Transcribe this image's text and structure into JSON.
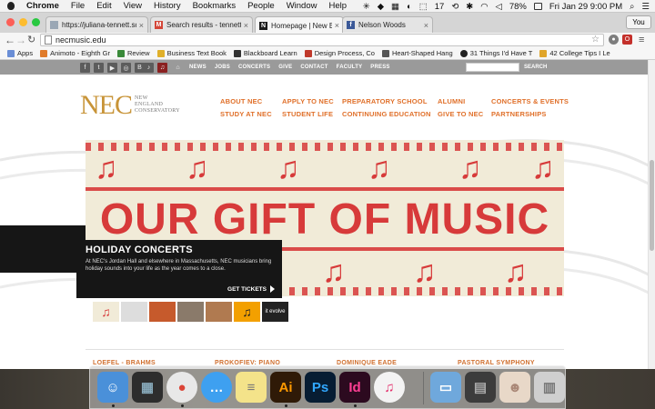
{
  "menubar": {
    "app": "Chrome",
    "items": [
      "File",
      "Edit",
      "View",
      "History",
      "Bookmarks",
      "People",
      "Window",
      "Help"
    ],
    "badge_count": "17",
    "battery": "78%",
    "clock": "Fri Jan 29  9:00 PM"
  },
  "tabs": [
    {
      "title": "https://juliana-tennett.squ",
      "icon_color": "#9aa7b5",
      "icon": "doc-icon"
    },
    {
      "title": "Search results - tennett.jl@",
      "icon_color": "#d44638",
      "icon": "gmail-icon"
    },
    {
      "title": "Homepage | New England C",
      "icon_color": "#1a1a1a",
      "icon": "nec-icon"
    },
    {
      "title": "Nelson Woods",
      "icon_color": "#3b5998",
      "icon": "facebook-icon"
    }
  ],
  "profile_label": "You",
  "url": "necmusic.edu",
  "bookmarks": [
    {
      "label": "Apps",
      "color": "#6a8ed6"
    },
    {
      "label": "Animoto - Eighth Gr",
      "color": "#e07b2a"
    },
    {
      "label": "Review",
      "color": "#3a8a3a"
    },
    {
      "label": "Business Text Book",
      "color": "#e0b02a"
    },
    {
      "label": "Blackboard Learn",
      "color": "#333333"
    },
    {
      "label": "Design Process, Co",
      "color": "#c0392b"
    },
    {
      "label": "Heart-Shaped Hang",
      "color": "#555555"
    },
    {
      "label": "31 Things I'd Have T",
      "color": "#222222"
    },
    {
      "label": "42 College Tips I Le",
      "color": "#e0a52a"
    }
  ],
  "site": {
    "top_nav": [
      "NEWS",
      "JOBS",
      "CONCERTS",
      "GIVE",
      "CONTACT",
      "FACULTY",
      "PRESS"
    ],
    "search_label": "SEARCH",
    "logo_main": "NEC",
    "logo_sub": [
      "NEW",
      "ENGLAND",
      "CONSERVATORY"
    ],
    "main_nav_row1": [
      "ABOUT NEC",
      "APPLY TO NEC",
      "PREPARATORY SCHOOL",
      "ALUMNI",
      "CONCERTS & EVENTS"
    ],
    "main_nav_row2": [
      "STUDY AT NEC",
      "STUDENT LIFE",
      "CONTINUING EDUCATION",
      "GIVE TO NEC",
      "PARTNERSHIPS"
    ],
    "hero_text": "OUR GIFT OF MUSIC",
    "hero_note_glyph": "♫",
    "promo_heading": "HOLIDAY CONCERTS",
    "promo_body": "At NEC's Jordan Hall and elsewhere in Massachusetts, NEC musicians bring holiday sounds into your life as the year comes to a close.",
    "promo_cta": "GET TICKETS",
    "thumb_last_label": "it evolve",
    "bottom_items": [
      "LOEFEL - BRAHMS",
      "PROKOFIEV: PIANO",
      "DOMINIQUE EADE",
      "PASTORAL SYMPHONY"
    ]
  },
  "dock": [
    {
      "name": "finder-icon",
      "bg": "#4a90d9",
      "glyph": "☺"
    },
    {
      "name": "mission-control-icon",
      "bg": "#2d2d2d",
      "glyph": "▦"
    },
    {
      "name": "chrome-icon",
      "bg": "#e8e8e8",
      "glyph": "●"
    },
    {
      "name": "messages-icon",
      "bg": "#3ea0f0",
      "glyph": "💬"
    },
    {
      "name": "notes-icon",
      "bg": "#f4e38a",
      "glyph": "≡"
    },
    {
      "name": "illustrator-icon",
      "bg": "#2f1a07",
      "glyph": "Ai"
    },
    {
      "name": "photoshop-icon",
      "bg": "#071d33",
      "glyph": "Ps"
    },
    {
      "name": "indesign-icon",
      "bg": "#2c0a1f",
      "glyph": "Id"
    },
    {
      "name": "itunes-icon",
      "bg": "#f3f3f3",
      "glyph": "♫"
    },
    {
      "name": "folder-icon",
      "bg": "#6fa8dc",
      "glyph": "▭"
    },
    {
      "name": "document-stack-icon",
      "bg": "#3c3c3c",
      "glyph": "▤"
    },
    {
      "name": "photo-icon",
      "bg": "#e8d8c8",
      "glyph": "☻"
    },
    {
      "name": "trash-icon",
      "bg": "#cfcfcf",
      "glyph": "🗑"
    }
  ],
  "colors": {
    "nec_orange": "#e0702a",
    "nec_gold": "#c89438",
    "knit_red": "#d73a3a",
    "knit_bg": "#f1ebd8"
  }
}
